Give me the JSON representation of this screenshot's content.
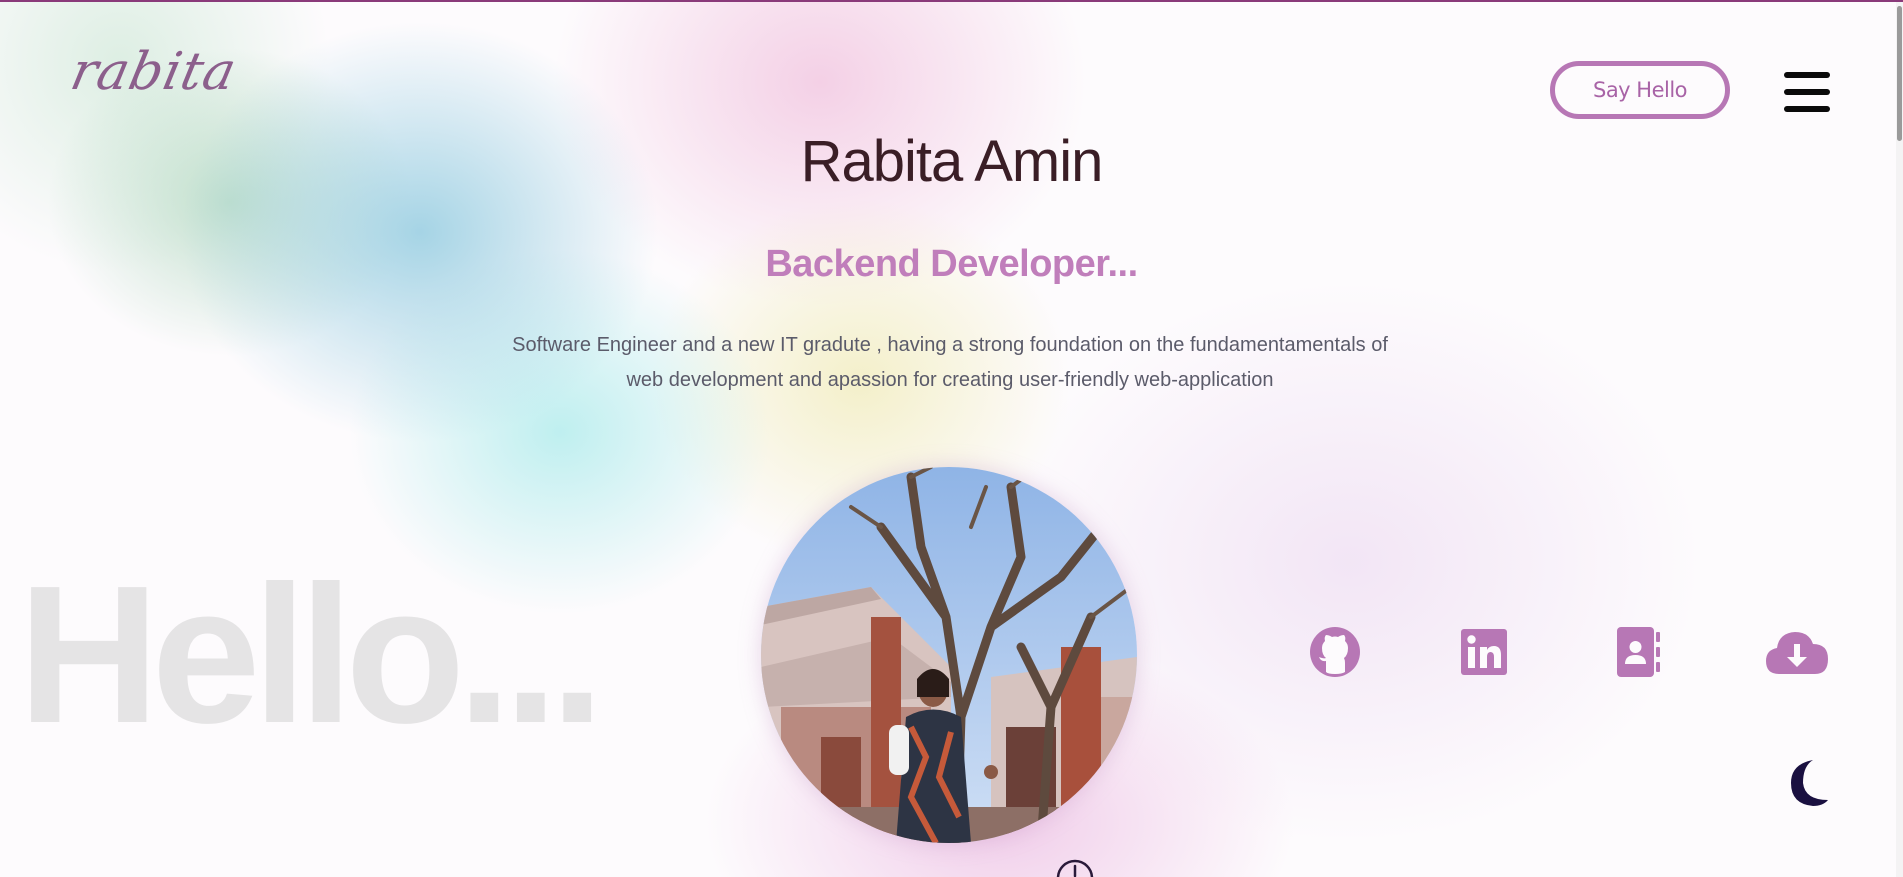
{
  "header": {
    "logo_text": "rabita",
    "say_hello_label": "Say Hello",
    "menu_icon": "hamburger-menu-icon"
  },
  "hero": {
    "name": "Rabita Amin",
    "role": "Backend Developer...",
    "bio_line1": "Software Engineer and a new IT gradute , having a strong foundation on the fundamentamentals of",
    "bio_line2": "web development and apassion for creating user-friendly web-application",
    "background_word": "Hello..."
  },
  "social_links": [
    {
      "name": "github",
      "icon": "github-icon"
    },
    {
      "name": "linkedin",
      "icon": "linkedin-icon"
    },
    {
      "name": "contact",
      "icon": "contact-book-icon"
    },
    {
      "name": "download",
      "icon": "cloud-download-icon"
    }
  ],
  "theme_toggle": {
    "icon": "moon-icon"
  },
  "scroll_indicator": {
    "icon": "scroll-down-icon"
  },
  "colors": {
    "accent": "#b777b5",
    "accent_text": "#c07ebb",
    "name_text": "#3a1e26",
    "body_text": "#5b5b6a",
    "moon": "#1a1040"
  }
}
